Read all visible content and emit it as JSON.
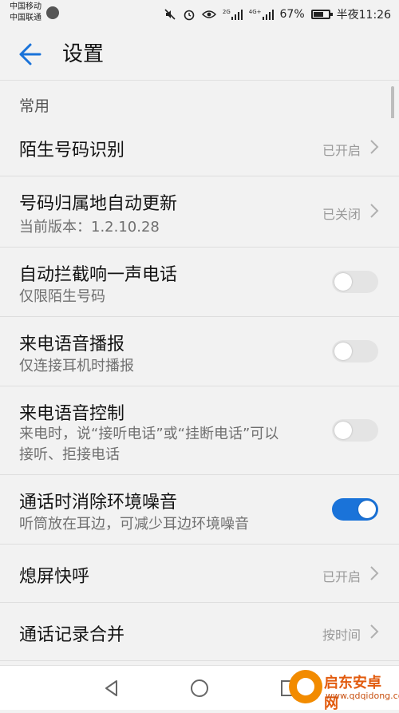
{
  "status": {
    "carrier1": "中国移动",
    "carrier2": "中国联通",
    "sim2_label": "2G",
    "sim1_label": "4G+",
    "battery": "67%",
    "battery_level": 0.67,
    "time": "半夜11:26"
  },
  "header": {
    "title": "设置"
  },
  "section": {
    "label": "常用"
  },
  "rows": [
    {
      "title": "陌生号码识别",
      "value": "已开启"
    },
    {
      "title": "号码归属地自动更新",
      "sub": "当前版本：1.2.10.28",
      "value": "已关闭"
    },
    {
      "title": "自动拦截响一声电话",
      "sub": "仅限陌生号码",
      "toggle": false
    },
    {
      "title": "来电语音播报",
      "sub": "仅连接耳机时播报",
      "toggle": false
    },
    {
      "title": "来电语音控制",
      "sub1": "来电时，说“接听电话”或“挂断电话”可以",
      "sub2": "接听、拒接电话",
      "toggle": false
    },
    {
      "title": "通话时消除环境噪音",
      "sub": "听筒放在耳边，可减少耳边环境噪音",
      "toggle": true
    },
    {
      "title": "熄屏快呼",
      "value": "已开启"
    },
    {
      "title": "通话记录合并",
      "value": "按时间"
    }
  ],
  "watermark": {
    "name": "启东安卓网",
    "url": "www.qdqidong.com"
  },
  "colors": {
    "accent": "#1a73d9",
    "background": "#f2f2f2"
  }
}
